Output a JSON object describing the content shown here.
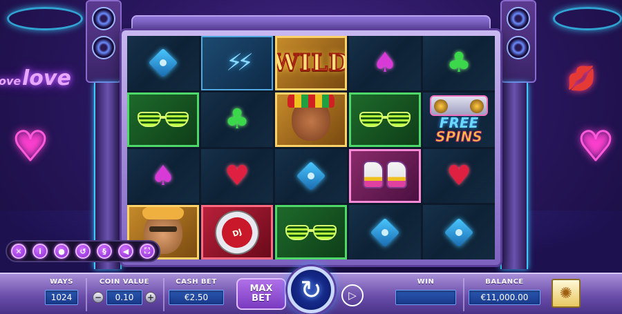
{
  "background": {
    "neon_word_1": "ove",
    "neon_word_2": "love",
    "heart_glyph": "♥",
    "lips_glyph": "💋"
  },
  "reels": [
    [
      {
        "symbol": "diamond",
        "bg": "plain"
      },
      {
        "symbol": "earrings",
        "bg": "blue",
        "glyph": "⚡⚡"
      },
      {
        "symbol": "wild",
        "bg": "gold",
        "text": "WILD"
      },
      {
        "symbol": "spade",
        "bg": "plain",
        "glyph": "♠"
      },
      {
        "symbol": "club",
        "bg": "plain",
        "glyph": "♣"
      }
    ],
    [
      {
        "symbol": "glasses",
        "bg": "green"
      },
      {
        "symbol": "club",
        "bg": "plain",
        "glyph": "♣"
      },
      {
        "symbol": "woman",
        "bg": "gold"
      },
      {
        "symbol": "glasses",
        "bg": "green"
      },
      {
        "symbol": "free-spins",
        "bg": "plain",
        "free": "FREE",
        "spins": "SPINS"
      }
    ],
    [
      {
        "symbol": "spade",
        "bg": "plain",
        "glyph": "♠"
      },
      {
        "symbol": "heart",
        "bg": "plain",
        "glyph": "♥"
      },
      {
        "symbol": "diamond",
        "bg": "plain"
      },
      {
        "symbol": "sneakers",
        "bg": "pink"
      },
      {
        "symbol": "heart",
        "bg": "plain",
        "glyph": "♥"
      }
    ],
    [
      {
        "symbol": "man",
        "bg": "gold"
      },
      {
        "symbol": "watch",
        "bg": "red",
        "text": "DJ"
      },
      {
        "symbol": "glasses",
        "bg": "green"
      },
      {
        "symbol": "diamond",
        "bg": "plain"
      },
      {
        "symbol": "diamond",
        "bg": "plain"
      }
    ]
  ],
  "toolbar": {
    "close": "✕",
    "info": "i",
    "settings": "●",
    "history": "↺",
    "rules": "§",
    "sound": "◀",
    "fullscreen": "⛶"
  },
  "bottom": {
    "ways_label": "WAYS",
    "ways_value": "1024",
    "coin_value_label": "COIN VALUE",
    "coin_value": "0.10",
    "coin_minus": "−",
    "coin_plus": "+",
    "cash_bet_label": "CASH BET",
    "cash_bet_value": "€2.50",
    "max_bet_line1": "MAX",
    "max_bet_line2": "BET",
    "spin_glyph": "↻",
    "autoplay_glyph": "▷",
    "win_label": "WIN",
    "win_value": "",
    "balance_label": "BALANCE",
    "balance_value": "€11,000.00",
    "provider_glyph": "✺"
  }
}
